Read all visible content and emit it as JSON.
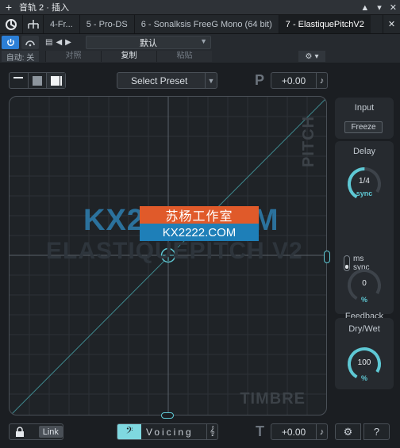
{
  "host": {
    "window_title": "音轨 2 · 插入",
    "tabs": [
      {
        "label": "4-Fr..."
      },
      {
        "label": "5 - Pro-DS"
      },
      {
        "label": "6 - Sonalksis FreeG Mono (64 bit)"
      },
      {
        "label": "7 - ElastiquePitchV2"
      }
    ],
    "auto_label": "自动: 关",
    "preset_name": "默认",
    "compare_label": "对照",
    "copy_label": "复制",
    "paste_label": "粘贴"
  },
  "plugin": {
    "select_preset": "Select Preset",
    "pitch_symbol": "P",
    "pitch_value": "+0.00",
    "timbre_symbol": "T",
    "timbre_value": "+0.00",
    "axis_pitch": "PITCH",
    "axis_timbre": "TIMBRE",
    "brand_text": "ELASTIQUEPITCH V2",
    "link_label": "Link",
    "voicing_label": "Voicing"
  },
  "panel": {
    "input_title": "Input",
    "freeze_label": "Freeze",
    "delay_title": "Delay",
    "delay_value": "1/4",
    "delay_unit": "sync",
    "delay_ms": "ms",
    "delay_sync": "sync",
    "feedback_title": "Feedback",
    "feedback_value": "0",
    "feedback_unit": "%",
    "drywet_title": "Dry/Wet",
    "drywet_value": "100",
    "drywet_unit": "%"
  },
  "watermark": {
    "big": "KX2222.COM",
    "top": "苏杨工作室",
    "bottom": "KX2222.COM"
  },
  "colors": {
    "accent": "#5ec8d4",
    "host_blue": "#2c7fd6",
    "panel_bg": "#262a2f",
    "background": "#1b1e22"
  }
}
